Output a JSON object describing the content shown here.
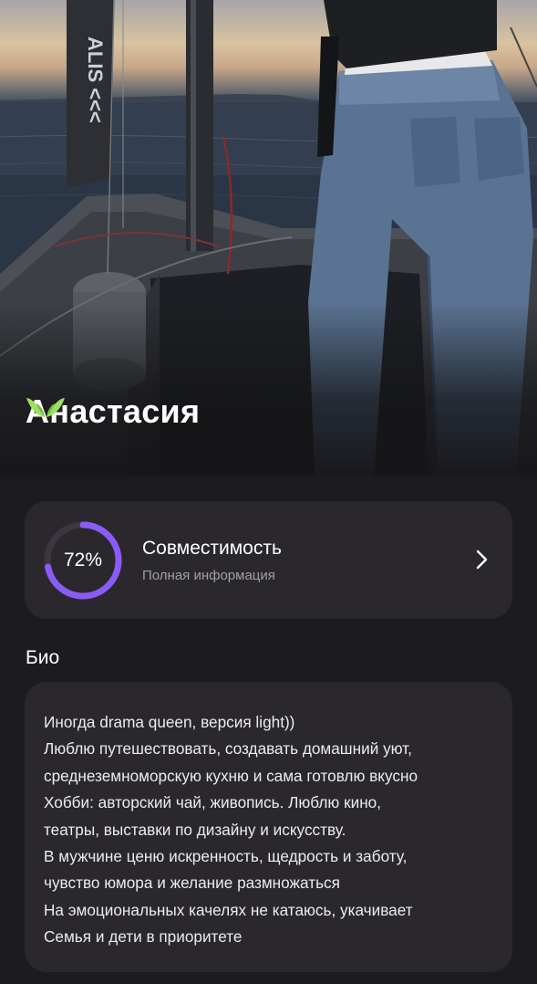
{
  "profile": {
    "name": "Анастасия",
    "verified_icon": "butterfly-icon",
    "verified_color": "#9be060"
  },
  "compatibility": {
    "percent_label": "72%",
    "percent_value": 0.72,
    "title": "Совместимость",
    "subtitle": "Полная информация",
    "ring_color": "#8a5cf6",
    "chevron_icon": "chevron-right-icon"
  },
  "bio": {
    "heading": "Био",
    "lines": [
      "Иногда drama queen, версия light))",
      "Люблю путешествовать, создавать домашний уют,",
      "среднеземноморскую кухню и сама готовлю вкусно",
      "Хобби: авторский чай, живопись. Люблю кино,",
      "театры, выставки  по дизайну и искусству.",
      "В мужчине ценю искренность, щедрость и заботу,",
      "чувство юмора и желание размножаться",
      "На эмоциональных качелях не катаюсь, укачивает",
      "Семья и дети в приоритете"
    ]
  }
}
